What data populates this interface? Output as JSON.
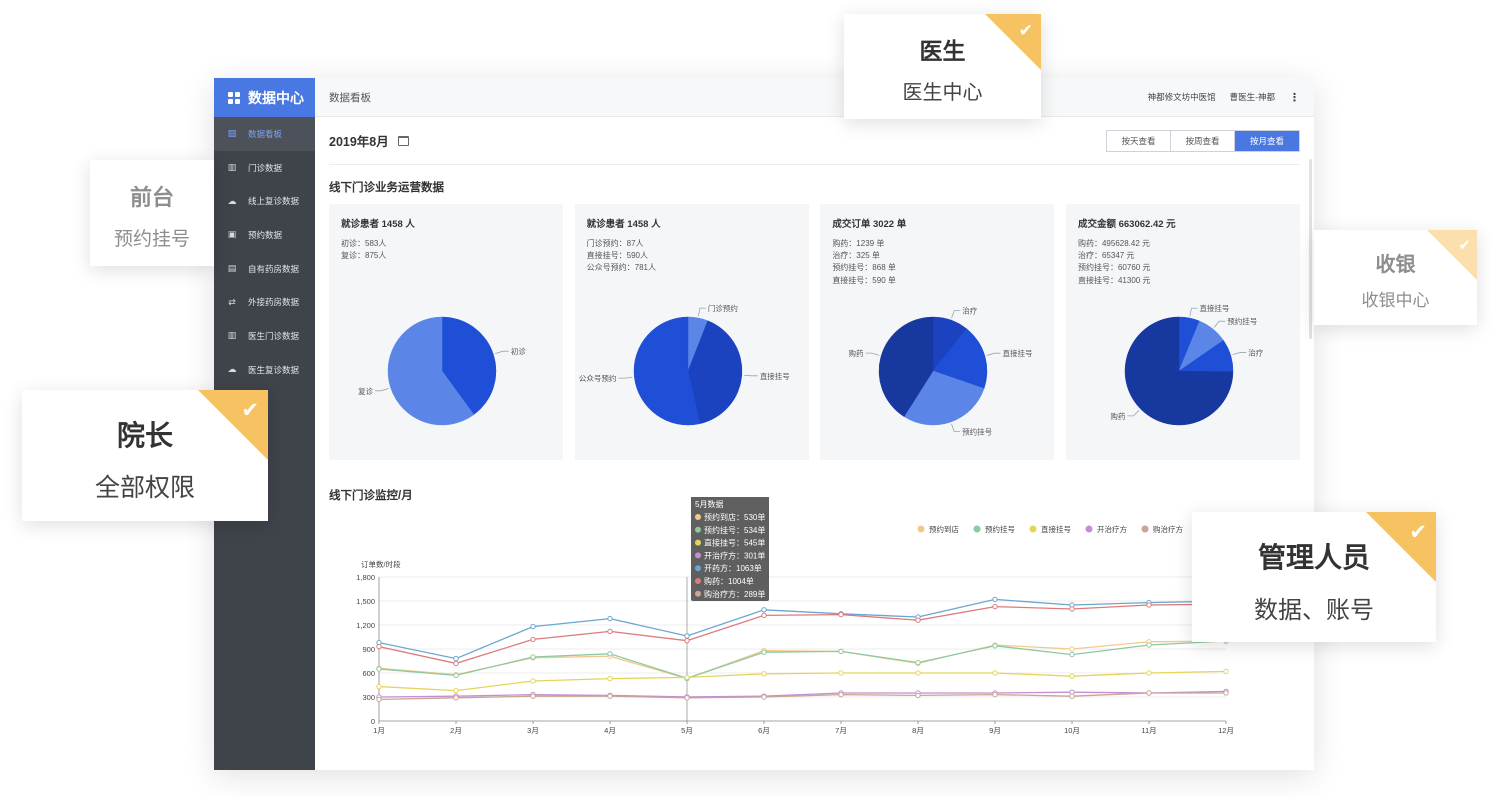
{
  "app": {
    "brand": "数据中心",
    "breadcrumb": "数据看板",
    "clinic": "神都修文坊中医馆",
    "user": "曹医生-神都",
    "more": "⋮"
  },
  "sidebar": {
    "items": [
      {
        "label": "数据看板",
        "icon": "chart-board-icon",
        "active": true
      },
      {
        "label": "门诊数据",
        "icon": "bar-chart-icon"
      },
      {
        "label": "线上复诊数据",
        "icon": "cloud-icon"
      },
      {
        "label": "预约数据",
        "icon": "calendar-clock-icon"
      },
      {
        "label": "自有药房数据",
        "icon": "pharmacy-icon"
      },
      {
        "label": "外接药房数据",
        "icon": "swap-icon"
      },
      {
        "label": "医生门诊数据",
        "icon": "bar-chart-icon"
      },
      {
        "label": "医生复诊数据",
        "icon": "cloud-icon"
      }
    ]
  },
  "filter": {
    "date": "2019年8月",
    "views": [
      "按天查看",
      "按周查看",
      "按月查看"
    ],
    "active_view": "按月查看"
  },
  "section1": {
    "title": "线下门诊业务运营数据"
  },
  "cards": [
    {
      "title": "就诊患者 1458 人",
      "lines": [
        "初诊：583人",
        "复诊：875人"
      ]
    },
    {
      "title": "就诊患者 1458 人",
      "lines": [
        "门诊预约：87人",
        "直接挂号：590人",
        "公众号预约：781人"
      ]
    },
    {
      "title": "成交订单 3022 单",
      "lines": [
        "购药：1239 单",
        "治疗：325 单",
        "预约挂号：868 单",
        "直接挂号：590 单"
      ]
    },
    {
      "title": "成交金额 663062.42 元",
      "lines": [
        "购药：495628.42 元",
        "治疗：65347 元",
        "预约挂号：60760 元",
        "直接挂号：41300 元"
      ]
    }
  ],
  "section2": {
    "title": "线下门诊监控/月"
  },
  "chart_data": [
    {
      "type": "pie",
      "slices": [
        {
          "label": "初诊",
          "value": 583,
          "color": "#1f4fd6"
        },
        {
          "label": "复诊",
          "value": 875,
          "color": "#5b86e8"
        }
      ]
    },
    {
      "type": "pie",
      "slices": [
        {
          "label": "门诊预约",
          "value": 87,
          "color": "#5b86e8"
        },
        {
          "label": "直接挂号",
          "value": 590,
          "color": "#1b43c0"
        },
        {
          "label": "公众号预约",
          "value": 781,
          "color": "#1f4fd6"
        }
      ]
    },
    {
      "type": "pie",
      "slices": [
        {
          "label": "治疗",
          "value": 325,
          "color": "#1b43c0"
        },
        {
          "label": "直接挂号",
          "value": 590,
          "color": "#1f4fd6"
        },
        {
          "label": "预约挂号",
          "value": 868,
          "color": "#5b86e8"
        },
        {
          "label": "购药",
          "value": 1239,
          "color": "#17389f"
        }
      ]
    },
    {
      "type": "pie",
      "slices": [
        {
          "label": "直接挂号",
          "value": 41300,
          "color": "#1f4fd6"
        },
        {
          "label": "预约挂号",
          "value": 60760,
          "color": "#5b86e8"
        },
        {
          "label": "治疗",
          "value": 65347,
          "color": "#1f4fd6"
        },
        {
          "label": "购药",
          "value": 495628.42,
          "color": "#17389f"
        }
      ]
    },
    {
      "type": "line",
      "ylabel": "订单数/时段",
      "ylim": [
        0,
        1800
      ],
      "yticks": [
        "0",
        "300",
        "600",
        "900",
        "1,200",
        "1,500",
        "1,800"
      ],
      "categories": [
        "1月",
        "2月",
        "3月",
        "4月",
        "5月",
        "6月",
        "7月",
        "8月",
        "9月",
        "10月",
        "11月",
        "12月"
      ],
      "grid": true,
      "legend_position": "top-right",
      "series": [
        {
          "name": "预约到店",
          "color": "#f3c98b",
          "values": [
            660,
            580,
            790,
            810,
            530,
            880,
            870,
            720,
            950,
            900,
            990,
            1000
          ]
        },
        {
          "name": "预约挂号",
          "color": "#8dc9a0",
          "values": [
            650,
            570,
            800,
            840,
            534,
            860,
            870,
            730,
            940,
            830,
            950,
            1000
          ]
        },
        {
          "name": "直接挂号",
          "color": "#e5d45a",
          "values": [
            430,
            380,
            500,
            530,
            545,
            590,
            600,
            600,
            600,
            560,
            600,
            620
          ]
        },
        {
          "name": "开治疗方",
          "color": "#c58ed0",
          "values": [
            300,
            310,
            330,
            320,
            301,
            310,
            350,
            350,
            350,
            360,
            350,
            370
          ]
        },
        {
          "name": "购治疗方",
          "color": "#c9a592",
          "values": [
            270,
            290,
            310,
            310,
            289,
            300,
            330,
            320,
            330,
            310,
            350,
            350
          ]
        },
        {
          "name": "开药方",
          "color": "#6aa6cf",
          "values": [
            980,
            780,
            1180,
            1280,
            1063,
            1390,
            1340,
            1300,
            1520,
            1450,
            1480,
            1500
          ]
        },
        {
          "name": "购药",
          "color": "#de7b7b",
          "values": [
            930,
            720,
            1020,
            1120,
            1004,
            1320,
            1330,
            1260,
            1430,
            1400,
            1450,
            1460
          ]
        }
      ]
    }
  ],
  "tooltip": {
    "title": "5月数据",
    "rows": [
      {
        "text": "预约到店：530单",
        "color": "#f3c98b"
      },
      {
        "text": "预约挂号：534单",
        "color": "#8dc9a0"
      },
      {
        "text": "直接挂号：545单",
        "color": "#e5d45a"
      },
      {
        "text": "开治疗方：301单",
        "color": "#c58ed0"
      },
      {
        "text": "开药方：1063单",
        "color": "#6aa6cf"
      },
      {
        "text": "购药：1004单",
        "color": "#de7b7b"
      },
      {
        "text": "购治疗方：289单",
        "color": "#c9a592"
      }
    ]
  },
  "roles": [
    {
      "title": "医生",
      "subtitle": "医生中心"
    },
    {
      "title": "前台",
      "subtitle": "预约挂号"
    },
    {
      "title": "收银",
      "subtitle": "收银中心"
    },
    {
      "title": "院长",
      "subtitle": "全部权限"
    },
    {
      "title": "管理人员",
      "subtitle": "数据、账号"
    }
  ],
  "check": "✔"
}
